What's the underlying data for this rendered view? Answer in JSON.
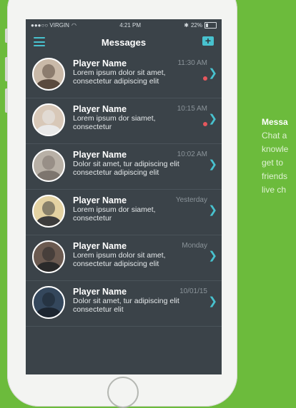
{
  "status": {
    "carrier": "●●●○○ VIRGIN",
    "time": "4:21 PM",
    "bluetooth": "✱",
    "battery": "22%"
  },
  "header": {
    "title": "Messages"
  },
  "messages": [
    {
      "name": "Player Name",
      "time": "11:30 AM",
      "preview": "Lorem ipsum dolor sit amet, consectetur adipiscing elit",
      "unread": true
    },
    {
      "name": "Player Name",
      "time": "10:15 AM",
      "preview": "Lorem ipsum dor siamet, consectetur",
      "unread": true
    },
    {
      "name": "Player Name",
      "time": "10:02 AM",
      "preview": "Dolor sit amet,  tur adipiscing elit consectetur adipiscing elit",
      "unread": false
    },
    {
      "name": "Player Name",
      "time": "Yesterday",
      "preview": "Lorem ipsum dor siamet, consectetur",
      "unread": false
    },
    {
      "name": "Player Name",
      "time": "Monday",
      "preview": "Lorem ipsum dolor sit amet, consectetur adipiscing elit",
      "unread": false
    },
    {
      "name": "Player Name",
      "time": "10/01/15",
      "preview": "Dolor sit amet,  tur adipiscing elit consectetur elit",
      "unread": false
    }
  ],
  "promo": {
    "heading": "Messa",
    "lines": [
      "Chat a",
      "knowle",
      "get to",
      "friends",
      "live ch"
    ]
  },
  "colors": {
    "accent": "#48c2cf",
    "background": "#6cbb3c",
    "screen": "#3b4349",
    "unread": "#e6575d"
  }
}
